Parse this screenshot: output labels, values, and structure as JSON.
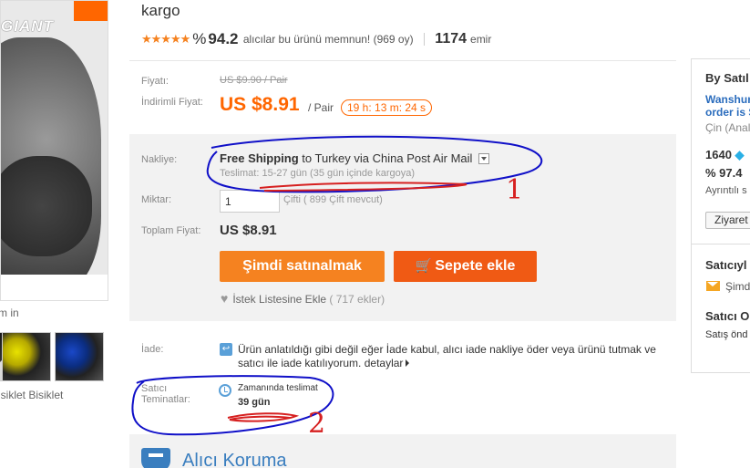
{
  "product": {
    "title_tail": "kargo",
    "brand_logo": "GIANT",
    "zoom_hint": "m in",
    "thumbnail_caption": "isiklet Bisiklet",
    "rating_stars": "★★★★★",
    "percent_sign": "%",
    "positive_percent": "94.2",
    "positive_text": "alıcılar bu ürünü memnun! (969 oy)",
    "orders_count": "1174",
    "orders_label": "emir"
  },
  "price": {
    "price_label": "Fiyatı:",
    "original_price": "US $9.90 / Pair",
    "discount_label": "İndirimli Fiyat:",
    "discount_price": "US $8.91",
    "unit": "/ Pair",
    "countdown": "19 h: 13 m: 24 s"
  },
  "shipping": {
    "label": "Nakliye:",
    "free": "Free Shipping",
    "to": "to",
    "destination": "Turkey via China Post Air Mail",
    "delivery_note": "Teslimat: 15-27 gün (35 gün içinde kargoya)"
  },
  "quantity": {
    "label": "Miktar:",
    "value": "1",
    "stock_note": "Çifti ( 899 Çift mevcut)"
  },
  "total": {
    "label": "Toplam Fiyat:",
    "value": "US $8.91"
  },
  "actions": {
    "buy_now": "Şimdi satınalmak",
    "add_to_cart": "Sepete ekle",
    "cart_icon": "🛒",
    "wishlist_label": "İstek Listesine Ekle",
    "wishlist_count": "( 717 ekler)"
  },
  "returns": {
    "label": "İade:",
    "text": "Ürün anlatıldığı gibi değil eğer İade kabul, alıcı iade nakliye öder veya ürünü tutmak ve satıcı ile iade katılıyorum.",
    "details_link": "detaylar"
  },
  "guarantees": {
    "label": "Satıcı Teminatlar:",
    "on_time_label": "Zamanında teslimat",
    "on_time_value": "39 gün"
  },
  "protection": {
    "title": "Alıcı Koruma"
  },
  "seller": {
    "heading": "By Satıl",
    "name_line1": "Wanshur",
    "name_line2": "order is S",
    "country": "Çin (Anal",
    "score": "1640",
    "positive": "% 97.4",
    "details": "Ayrıntılı s",
    "visit_button": "Ziyaret",
    "section_contact": "Satıcıyl",
    "contact_now": "Şimd",
    "section_sales": "Satıcı O",
    "sales_text": "Satış önd"
  },
  "annotations": {
    "mark_1": "1",
    "mark_2": "2",
    "ink_color": "#1010c8",
    "red_color": "#d62020"
  }
}
